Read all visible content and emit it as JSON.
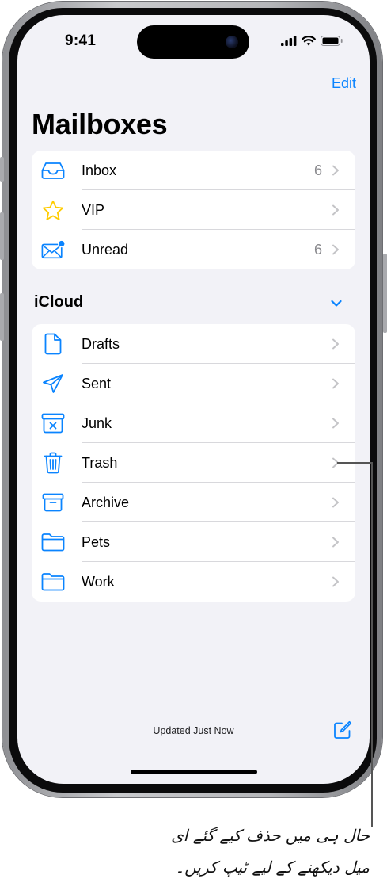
{
  "status_bar": {
    "time": "9:41"
  },
  "header": {
    "edit_label": "Edit",
    "title": "Mailboxes"
  },
  "primary_mailboxes": [
    {
      "label": "Inbox",
      "count": "6",
      "icon": "tray-icon"
    },
    {
      "label": "VIP",
      "count": "",
      "icon": "star-icon"
    },
    {
      "label": "Unread",
      "count": "6",
      "icon": "unread-envelope-icon"
    }
  ],
  "account_section": {
    "label": "iCloud"
  },
  "account_mailboxes": [
    {
      "label": "Drafts",
      "icon": "document-icon"
    },
    {
      "label": "Sent",
      "icon": "paper-plane-icon"
    },
    {
      "label": "Junk",
      "icon": "junk-bin-icon"
    },
    {
      "label": "Trash",
      "icon": "trash-icon"
    },
    {
      "label": "Archive",
      "icon": "archive-box-icon"
    },
    {
      "label": "Pets",
      "icon": "folder-icon"
    },
    {
      "label": "Work",
      "icon": "folder-icon"
    }
  ],
  "toolbar": {
    "status": "Updated Just Now"
  },
  "callout": {
    "line1": "حال ہی میں حذف کیے گئے ای",
    "line2": "میل دیکھنے کے لیے ٹیپ کریں۔"
  },
  "colors": {
    "accent": "#0a84ff",
    "vip_star": "#ffcc00",
    "background": "#f2f2f7"
  }
}
